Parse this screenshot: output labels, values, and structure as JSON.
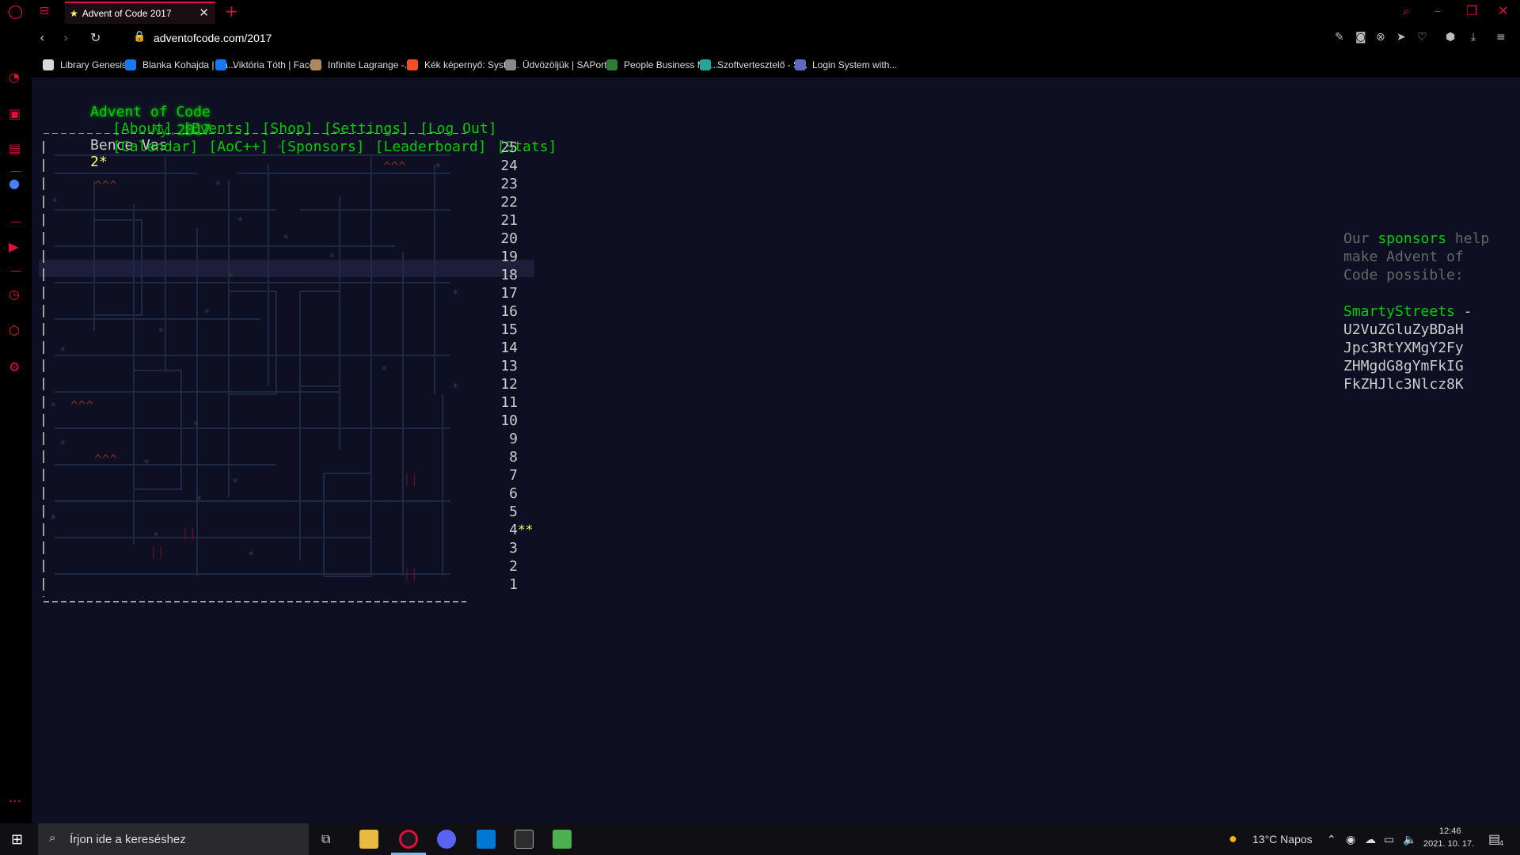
{
  "browser": {
    "tab_title": "Advent of Code 2017",
    "tab_star": "★",
    "tab_close": "✕",
    "new_tab": "+",
    "url": "adventofcode.com/2017"
  },
  "bookmarks": [
    {
      "label": "Library Genesis",
      "color": "#d9d9d9"
    },
    {
      "label": "Blanka Kohajda | Fa...",
      "color": "#1877f2"
    },
    {
      "label": "Viktória Tóth | Face...",
      "color": "#1877f2"
    },
    {
      "label": "Infinite Lagrange -...",
      "color": "#b08860"
    },
    {
      "label": "Kék képernyő: Syste...",
      "color": "#f25022"
    },
    {
      "label": "Üdvözöljük | SAPortál",
      "color": "#888888"
    },
    {
      "label": "People Business Me...",
      "color": "#2e7d32"
    },
    {
      "label": "Szoftvertesztelő - S...",
      "color": "#26a69a"
    },
    {
      "label": "Login System with...",
      "color": "#5c6bc0"
    }
  ],
  "aoc": {
    "title": "Advent of Code",
    "year_prefix": "λy.",
    "year": "2017",
    "nav_row1": [
      "[About]",
      "[Events]",
      "[Shop]",
      "[Settings]",
      "[Log Out]"
    ],
    "user": "Bence Vas",
    "user_stars": "2*",
    "nav_row2": [
      "[Calendar]",
      "[AoC++]",
      "[Sponsors]",
      "[Leaderboard]",
      "[Stats]"
    ],
    "days": [
      "25",
      "24",
      "23",
      "22",
      "21",
      "20",
      "19",
      "18",
      "17",
      "16",
      "15",
      "14",
      "13",
      "12",
      "11",
      "10",
      "9",
      "8",
      "7",
      "6",
      "5",
      "4",
      "3",
      "2",
      "1"
    ],
    "day4_stars": "**",
    "highlighted_day": "23",
    "sponsor": {
      "intro_1": "Our",
      "intro_link": "sponsors",
      "intro_2": "help",
      "intro_3": "make Advent of",
      "intro_4": "Code possible:",
      "name": "SmartyStreets",
      "dash": "-",
      "code": "U2VuZGluZyBDaH\nJpc3RtYXMgY2Fy\nZHMgdG8gYmFkIG\nFkZHJlc3Nlcz8K"
    }
  },
  "taskbar": {
    "search_placeholder": "Írjon ide a kereséshez",
    "weather": "13°C  Napos",
    "time": "12:46",
    "date": "2021. 10. 17.",
    "notif_count": "4"
  },
  "colors": {
    "accent": "#e0103a",
    "aoc_bg": "#0f0f23",
    "aoc_green": "#00cc00",
    "aoc_gold": "#ffff66"
  }
}
